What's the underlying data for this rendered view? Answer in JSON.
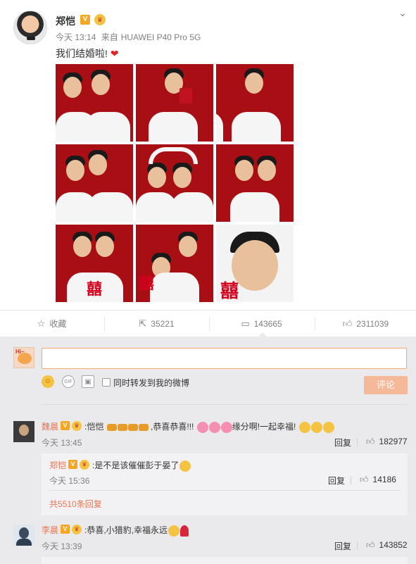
{
  "post": {
    "author": "郑恺",
    "verified_badge": "V",
    "member_badge": "♛",
    "time": "今天 13:14",
    "source_prefix": "来自",
    "source_device": "HUAWEI P40 Pro 5G",
    "text": "我们结婚啦!",
    "text_emoji": "❤",
    "menu_icon": "chevron-down-icon",
    "photo_count": 9
  },
  "actions": {
    "favorite_label": "收藏",
    "repost_count": "35221",
    "comment_count": "143665",
    "like_count": "2311039"
  },
  "compose": {
    "input_value": "",
    "also_repost_label": "同时转发到我的微博",
    "submit_label": "评论",
    "submit_color": "#f5b99a"
  },
  "comments": [
    {
      "name": "魏晨",
      "text_main": ":恺恺",
      "text_mid": ",恭喜恭喜!!!",
      "text_tail": "缘分啊!一起幸福!",
      "time": "今天 13:45",
      "reply_label": "回复",
      "likes": "182977",
      "sub": {
        "name": "郑恺",
        "text": ":是不是该催催彭于晏了",
        "time": "今天 15:36",
        "reply_label": "回复",
        "likes": "14186",
        "more_label": "共5510条回复"
      }
    },
    {
      "name": "李晨",
      "text": ":恭喜,小猎豹,幸福永远",
      "time": "今天 13:39",
      "reply_label": "回复",
      "likes": "143852"
    }
  ],
  "colors": {
    "accent": "#eb7350",
    "photo_bg": "#a70f14",
    "verified": "#f5a623",
    "comments_bg": "#eaeaec"
  }
}
